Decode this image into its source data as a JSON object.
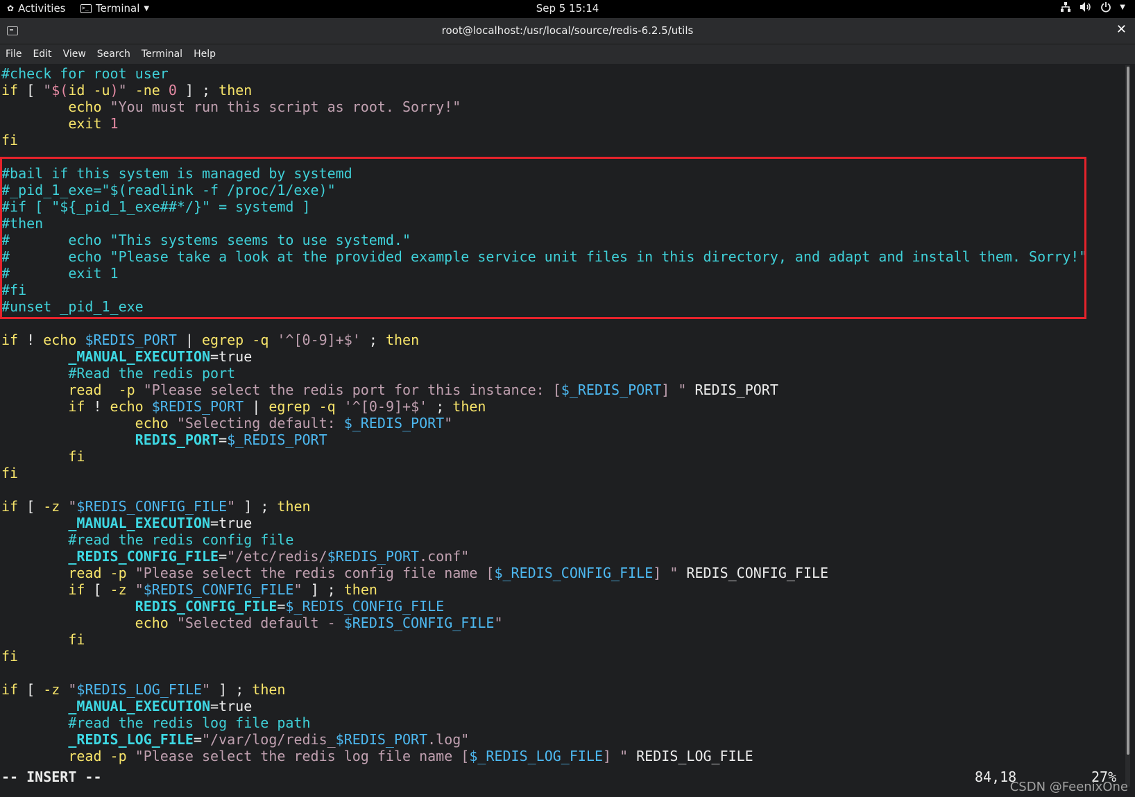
{
  "topbar": {
    "activities_label": "Activities",
    "app_label": "Terminal",
    "clock": "Sep 5  15:14",
    "icons": [
      "network-icon",
      "volume-icon",
      "power-icon"
    ]
  },
  "window": {
    "title": "root@localhost:/usr/local/source/redis-6.2.5/utils"
  },
  "menu": [
    "File",
    "Edit",
    "View",
    "Search",
    "Terminal",
    "Help"
  ],
  "colors": {
    "comment": "#3fd0d8",
    "keyword": "#f7e46a",
    "string": "#c0a0b0",
    "variable": "#4db8f0",
    "highlight_border": "#e5232b"
  },
  "lines": [
    [
      [
        "c",
        "#check for root user"
      ]
    ],
    [
      [
        "y",
        "if"
      ],
      [
        "w",
        " [ "
      ],
      [
        "s",
        "\""
      ],
      [
        "m",
        "$("
      ],
      [
        "y",
        "id -u"
      ],
      [
        "m",
        ")"
      ],
      [
        "s",
        "\""
      ],
      [
        "y",
        " -ne "
      ],
      [
        "m",
        "0"
      ],
      [
        "w",
        " ] ; "
      ],
      [
        "y",
        "then"
      ]
    ],
    [
      [
        "w",
        "        "
      ],
      [
        "y",
        "echo"
      ],
      [
        "w",
        " "
      ],
      [
        "s",
        "\"You must run this script as root. Sorry!\""
      ]
    ],
    [
      [
        "w",
        "        "
      ],
      [
        "y",
        "exit"
      ],
      [
        "w",
        " "
      ],
      [
        "m",
        "1"
      ]
    ],
    [
      [
        "y",
        "fi"
      ]
    ],
    [
      [
        "w",
        ""
      ]
    ],
    [
      [
        "c",
        "#bail if this system is managed by systemd"
      ]
    ],
    [
      [
        "c",
        "#_pid_1_exe=\"$(readlink -f /proc/1/exe)\""
      ]
    ],
    [
      [
        "c",
        "#if [ \"${_pid_1_exe##*/}\" = systemd ]"
      ]
    ],
    [
      [
        "c",
        "#then"
      ]
    ],
    [
      [
        "c",
        "#       echo \"This systems seems to use systemd.\""
      ]
    ],
    [
      [
        "c",
        "#       echo \"Please take a look at the provided example service unit files in this directory, and adapt and install them. Sorry!\""
      ]
    ],
    [
      [
        "c",
        "#       exit 1"
      ]
    ],
    [
      [
        "c",
        "#fi"
      ]
    ],
    [
      [
        "c",
        "#unset _pid_1_exe"
      ]
    ],
    [
      [
        "w",
        ""
      ]
    ],
    [
      [
        "y",
        "if"
      ],
      [
        "w",
        " ! "
      ],
      [
        "y",
        "echo"
      ],
      [
        "w",
        " "
      ],
      [
        "v",
        "$REDIS_PORT"
      ],
      [
        "w",
        " | "
      ],
      [
        "y",
        "egrep"
      ],
      [
        "w",
        " "
      ],
      [
        "y",
        "-q"
      ],
      [
        "w",
        " "
      ],
      [
        "s",
        "'^[0-9]+$'"
      ],
      [
        "w",
        " ; "
      ],
      [
        "y",
        "then"
      ]
    ],
    [
      [
        "w",
        "        "
      ],
      [
        "b",
        "_MANUAL_EXECUTION"
      ],
      [
        "w",
        "=true"
      ]
    ],
    [
      [
        "w",
        "        "
      ],
      [
        "c",
        "#Read the redis port"
      ]
    ],
    [
      [
        "w",
        "        "
      ],
      [
        "y",
        "read"
      ],
      [
        "w",
        "  "
      ],
      [
        "y",
        "-p"
      ],
      [
        "w",
        " "
      ],
      [
        "s",
        "\"Please select the redis port for this instance: ["
      ],
      [
        "v",
        "$_REDIS_PORT"
      ],
      [
        "s",
        "] \""
      ],
      [
        "w",
        " REDIS_PORT"
      ]
    ],
    [
      [
        "w",
        "        "
      ],
      [
        "y",
        "if"
      ],
      [
        "w",
        " ! "
      ],
      [
        "y",
        "echo"
      ],
      [
        "w",
        " "
      ],
      [
        "v",
        "$REDIS_PORT"
      ],
      [
        "w",
        " | "
      ],
      [
        "y",
        "egrep"
      ],
      [
        "w",
        " "
      ],
      [
        "y",
        "-q"
      ],
      [
        "w",
        " "
      ],
      [
        "s",
        "'^[0-9]+$'"
      ],
      [
        "w",
        " ; "
      ],
      [
        "y",
        "then"
      ]
    ],
    [
      [
        "w",
        "                "
      ],
      [
        "y",
        "echo"
      ],
      [
        "w",
        " "
      ],
      [
        "s",
        "\"Selecting default: "
      ],
      [
        "v",
        "$_REDIS_PORT"
      ],
      [
        "s",
        "\""
      ]
    ],
    [
      [
        "w",
        "                "
      ],
      [
        "b",
        "REDIS_PORT"
      ],
      [
        "w",
        "="
      ],
      [
        "v",
        "$_REDIS_PORT"
      ]
    ],
    [
      [
        "w",
        "        "
      ],
      [
        "y",
        "fi"
      ]
    ],
    [
      [
        "y",
        "fi"
      ]
    ],
    [
      [
        "w",
        ""
      ]
    ],
    [
      [
        "y",
        "if"
      ],
      [
        "w",
        " [ "
      ],
      [
        "y",
        "-z"
      ],
      [
        "w",
        " "
      ],
      [
        "s",
        "\""
      ],
      [
        "v",
        "$REDIS_CONFIG_FILE"
      ],
      [
        "s",
        "\""
      ],
      [
        "w",
        " ] ; "
      ],
      [
        "y",
        "then"
      ]
    ],
    [
      [
        "w",
        "        "
      ],
      [
        "b",
        "_MANUAL_EXECUTION"
      ],
      [
        "w",
        "=true"
      ]
    ],
    [
      [
        "w",
        "        "
      ],
      [
        "c",
        "#read the redis config file"
      ]
    ],
    [
      [
        "w",
        "        "
      ],
      [
        "b",
        "_REDIS_CONFIG_FILE"
      ],
      [
        "w",
        "="
      ],
      [
        "s",
        "\"/etc/redis/"
      ],
      [
        "v",
        "$REDIS_PORT"
      ],
      [
        "s",
        ".conf\""
      ]
    ],
    [
      [
        "w",
        "        "
      ],
      [
        "y",
        "read"
      ],
      [
        "w",
        " "
      ],
      [
        "y",
        "-p"
      ],
      [
        "w",
        " "
      ],
      [
        "s",
        "\"Please select the redis config file name ["
      ],
      [
        "v",
        "$_REDIS_CONFIG_FILE"
      ],
      [
        "s",
        "] \""
      ],
      [
        "w",
        " REDIS_CONFIG_FILE"
      ]
    ],
    [
      [
        "w",
        "        "
      ],
      [
        "y",
        "if"
      ],
      [
        "w",
        " [ "
      ],
      [
        "y",
        "-z"
      ],
      [
        "w",
        " "
      ],
      [
        "s",
        "\""
      ],
      [
        "v",
        "$REDIS_CONFIG_FILE"
      ],
      [
        "s",
        "\""
      ],
      [
        "w",
        " ] ; "
      ],
      [
        "y",
        "then"
      ]
    ],
    [
      [
        "w",
        "                "
      ],
      [
        "b",
        "REDIS_CONFIG_FILE"
      ],
      [
        "w",
        "="
      ],
      [
        "v",
        "$_REDIS_CONFIG_FILE"
      ]
    ],
    [
      [
        "w",
        "                "
      ],
      [
        "y",
        "echo"
      ],
      [
        "w",
        " "
      ],
      [
        "s",
        "\"Selected default - "
      ],
      [
        "v",
        "$REDIS_CONFIG_FILE"
      ],
      [
        "s",
        "\""
      ]
    ],
    [
      [
        "w",
        "        "
      ],
      [
        "y",
        "fi"
      ]
    ],
    [
      [
        "y",
        "fi"
      ]
    ],
    [
      [
        "w",
        ""
      ]
    ],
    [
      [
        "y",
        "if"
      ],
      [
        "w",
        " [ "
      ],
      [
        "y",
        "-z"
      ],
      [
        "w",
        " "
      ],
      [
        "s",
        "\""
      ],
      [
        "v",
        "$REDIS_LOG_FILE"
      ],
      [
        "s",
        "\""
      ],
      [
        "w",
        " ] ; "
      ],
      [
        "y",
        "then"
      ]
    ],
    [
      [
        "w",
        "        "
      ],
      [
        "b",
        "_MANUAL_EXECUTION"
      ],
      [
        "w",
        "=true"
      ]
    ],
    [
      [
        "w",
        "        "
      ],
      [
        "c",
        "#read the redis log file path"
      ]
    ],
    [
      [
        "w",
        "        "
      ],
      [
        "b",
        "_REDIS_LOG_FILE"
      ],
      [
        "w",
        "="
      ],
      [
        "s",
        "\"/var/log/redis_"
      ],
      [
        "v",
        "$REDIS_PORT"
      ],
      [
        "s",
        ".log\""
      ]
    ],
    [
      [
        "w",
        "        "
      ],
      [
        "y",
        "read"
      ],
      [
        "w",
        " "
      ],
      [
        "y",
        "-p"
      ],
      [
        "w",
        " "
      ],
      [
        "s",
        "\"Please select the redis log file name ["
      ],
      [
        "v",
        "$_REDIS_LOG_FILE"
      ],
      [
        "s",
        "] \""
      ],
      [
        "w",
        " REDIS_LOG_FILE"
      ]
    ]
  ],
  "status": {
    "mode": "-- INSERT --",
    "position": "84,18",
    "percent": "27%"
  },
  "watermark": "CSDN @FeenixOne"
}
